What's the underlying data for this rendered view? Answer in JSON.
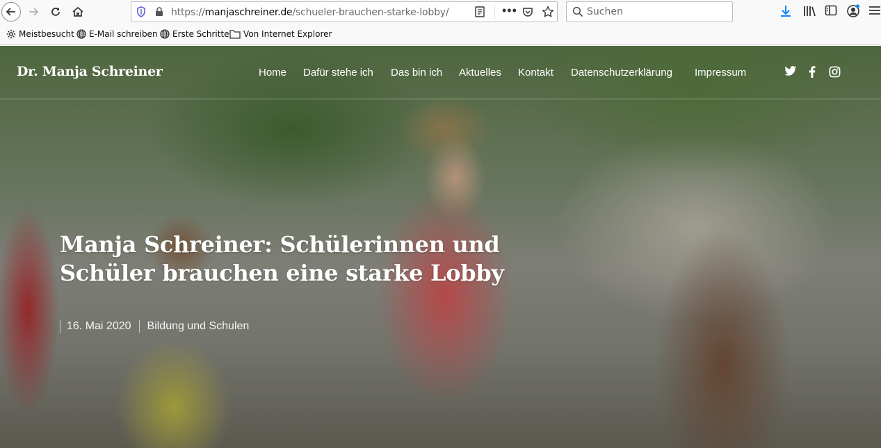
{
  "browser": {
    "url_prefix": "https://",
    "url_domain": "manjaschreiner.de",
    "url_path": "/schueler-brauchen-starke-lobby/",
    "url_dots": "•••",
    "search_placeholder": "Suchen"
  },
  "bookmarks": [
    {
      "label": "Meistbesucht",
      "icon": "gear-icon"
    },
    {
      "label": "E-Mail schreiben",
      "icon": "globe-icon"
    },
    {
      "label": "Erste Schritte",
      "icon": "globe-icon"
    },
    {
      "label": "Von Internet Explorer",
      "icon": "folder-icon"
    }
  ],
  "site": {
    "title": "Dr. Manja Schreiner",
    "menu": [
      "Home",
      "Dafür stehe ich",
      "Das bin ich",
      "Aktuelles",
      "Kontakt",
      "Datenschutzerklärung",
      "Impressum"
    ],
    "social": [
      "twitter-icon",
      "facebook-icon",
      "instagram-icon"
    ]
  },
  "post": {
    "title": "Manja Schreiner: Schülerinnen und Schüler brauchen eine starke Lobby",
    "date": "16. Mai 2020",
    "category": "Bildung und Schulen"
  },
  "colors": {
    "toolbar_bg": "#f9f9fa",
    "download_blue": "#0a84ff",
    "text_white": "#ffffff"
  }
}
